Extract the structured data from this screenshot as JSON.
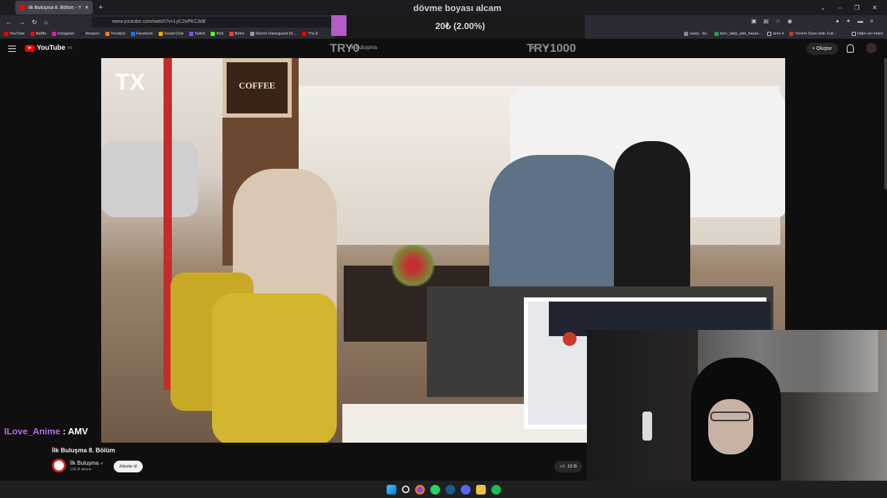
{
  "browser": {
    "tab_title": "İlk Buluşma 8. Bölüm - You",
    "url": "www.youtube.com/watch?v=LyC2oPKC3d8",
    "bookmarks": [
      {
        "label": "YouTube",
        "color": "#ff0000"
      },
      {
        "label": "Netflix",
        "color": "#e50914"
      },
      {
        "label": "Instagram",
        "color": "#d6249f"
      },
      {
        "label": "Amazon",
        "color": "#222222"
      },
      {
        "label": "Trendyol",
        "color": "#f27a1a"
      },
      {
        "label": "Facebook",
        "color": "#1877f2"
      },
      {
        "label": "Social Club",
        "color": "#f7a400"
      },
      {
        "label": "Twitch",
        "color": "#9146ff"
      },
      {
        "label": "Kick",
        "color": "#53fc18"
      },
      {
        "label": "Botrix",
        "color": "#ff3b3b"
      },
      {
        "label": "Skyrim Dawnguard DL...",
        "color": "#999999"
      },
      {
        "label": "The E",
        "color": "#ff0000"
      }
    ],
    "bookmarks_right": [
      {
        "label": "easty - Ek..",
        "color": "#888888"
      },
      {
        "label": "borc_takip_afet_hasan...",
        "color": "#1f9d55"
      },
      {
        "label": "sims 4",
        "color": "#cccccc"
      },
      {
        "label": "Torrent Oyun indir, Full...",
        "color": "#c0392b"
      }
    ],
    "other_bookmarks": "Diğer yer imleri"
  },
  "youtube": {
    "logo": "YouTube",
    "logo_sup": "TR",
    "search_value": "ilk buluşma",
    "create_label": "Oluştur"
  },
  "stream_overlay": {
    "title": "dövme boyası alcam",
    "goal_amount": "20₺ (2.00%)",
    "goal_min": "TRY0",
    "goal_max": "TRY1000",
    "goal_progress": 0.02,
    "song_user": "ILove_Anime",
    "song_sep": " : ",
    "song_name": "AMV"
  },
  "video": {
    "title": "İlk Buluşma 8. Bölüm",
    "channel": "İlk Buluşma",
    "subscribers": "106 B abone",
    "subscribe_label": "Abone ol",
    "likes": "15 B",
    "sign_text": "COFFEE",
    "network_logo": "TX"
  },
  "colors": {
    "accent": "#ff0000",
    "goal_bar": "#b45cc8",
    "song_user": "#b26de6"
  },
  "taskbar_icons": [
    "windows-start-icon",
    "search-icon",
    "firefox-icon",
    "whatsapp-icon",
    "steam-icon",
    "discord-icon",
    "file-explorer-icon",
    "spotify-icon"
  ]
}
